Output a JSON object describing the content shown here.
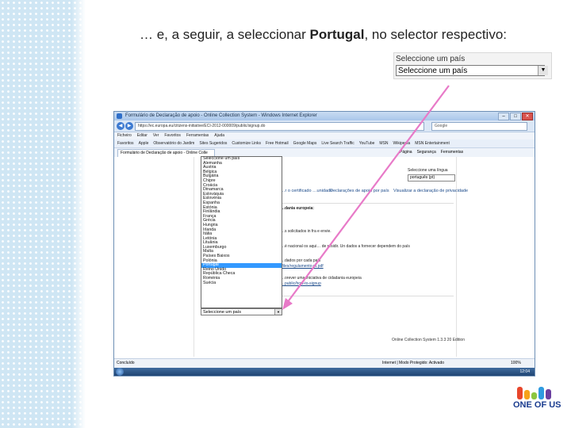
{
  "slide": {
    "title_prefix": "… e, a seguir, a seleccionar ",
    "title_bold": "Portugal",
    "title_suffix": ", no selector respectivo:"
  },
  "select_panel": {
    "label": "Seleccione um país",
    "value": "Seleccione um país"
  },
  "browser": {
    "window_title": "Formulário de Declaração de apoio - Online Collection System - Windows Internet Explorer",
    "url": "https://ec.europa.eu/citizens-initiative/ECI-2012-000009/public/signup.do",
    "search_engine": "Google",
    "menu": [
      "Ficheiro",
      "Editar",
      "Ver",
      "Favoritos",
      "Ferramentas",
      "Ajuda"
    ],
    "favorites": [
      "Favoritos",
      "Apple",
      "Observatório do Jardim",
      "Sites Sugeridos",
      "Customize Links",
      "Free Hotmail",
      "Google Maps",
      "Live Search Traffic",
      "YouTube",
      "MSN",
      "Wikipedia",
      "MSN Entertainment"
    ],
    "tab_title": "Formulário de Declaração de apoio - Online Colle",
    "tools": [
      "Página",
      "Segurança",
      "Ferramentas"
    ],
    "lang_label": "Seleccione uma língua",
    "lang_value": "português (pt)",
    "section_1": "…r o certificado …unidade",
    "section_2": "Declarações de apoio por país",
    "section_3": "Visualizar a declaração de privacidade",
    "line_1": "…dania europeia:",
    "line_2": "…s solicitados in fra e envie.",
    "line_3": "…é nacional os aqui… de residir. Un dados a fornecer dependem do país",
    "line_4": "…dados por cada país",
    "line_5": "/files/regulamento-pt.pdf",
    "line_6": "…orever uma Iniciativa de cidadania europeia",
    "line_7": "…public/how-to-signup",
    "footer": "Online Collection System 1.3.3 20 Edition",
    "status_left": "Concluído",
    "status_mid": "Internet | Modo Protegido: Activado",
    "zoom": "100%",
    "clock": "12:04"
  },
  "dropdown": {
    "options": [
      "Seleccione um país",
      "Alemanha",
      "Áustria",
      "Bélgica",
      "Bulgária",
      "Chipre",
      "Croácia",
      "Dinamarca",
      "Eslováquia",
      "Eslovénia",
      "Espanha",
      "Estónia",
      "Finlândia",
      "França",
      "Grécia",
      "Hungria",
      "Irlanda",
      "Itália",
      "Letónia",
      "Lituânia",
      "Luxemburgo",
      "Malta",
      "Países Baixos",
      "Polónia",
      "Portugal",
      "Reino Unido",
      "República Checa",
      "Roménia",
      "Suécia"
    ],
    "highlighted": "Portugal",
    "selected_value": "Seleccione um país"
  },
  "logo": {
    "text": "ONE OF US"
  },
  "colors": {
    "arrow": "#e87ac8",
    "highlight": "#3399ff",
    "logo_text": "#1a3c8f"
  }
}
